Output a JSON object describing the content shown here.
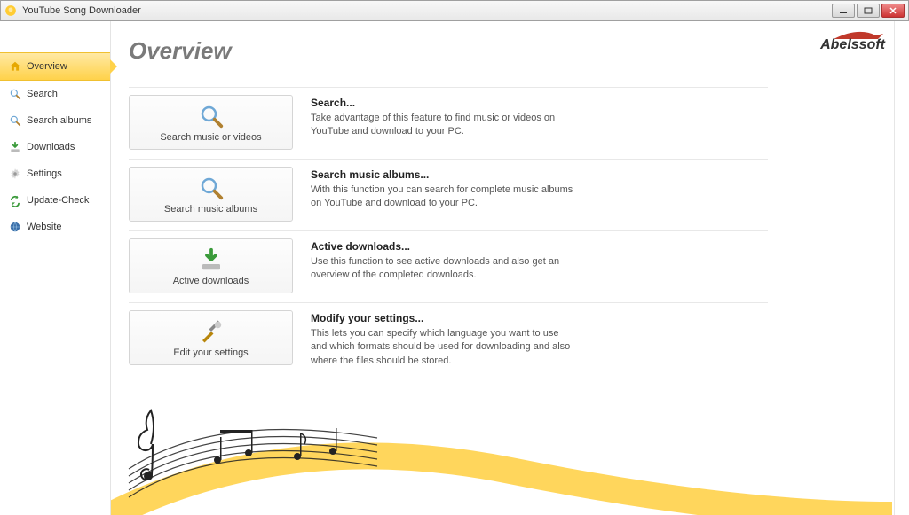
{
  "window": {
    "title": "YouTube Song Downloader"
  },
  "brand": {
    "name": "Abelssoft"
  },
  "page": {
    "title": "Overview"
  },
  "sidebar": {
    "items": [
      {
        "label": "Overview",
        "icon": "home-icon"
      },
      {
        "label": "Search",
        "icon": "search-icon"
      },
      {
        "label": "Search albums",
        "icon": "search-icon"
      },
      {
        "label": "Downloads",
        "icon": "download-icon"
      },
      {
        "label": "Settings",
        "icon": "gear-icon"
      },
      {
        "label": "Update-Check",
        "icon": "refresh-icon"
      },
      {
        "label": "Website",
        "icon": "globe-icon"
      }
    ]
  },
  "cards": [
    {
      "button_label": "Search music or videos",
      "title": "Search...",
      "desc": "Take advantage of this feature to find music or videos on YouTube and download to your PC.",
      "icon": "search-icon"
    },
    {
      "button_label": "Search music albums",
      "title": "Search music albums...",
      "desc": "With this function you can search for complete music albums on YouTube and download to your PC.",
      "icon": "search-icon"
    },
    {
      "button_label": "Active downloads",
      "title": "Active downloads...",
      "desc": "Use this function to see active downloads and also get an overview of the completed downloads.",
      "icon": "download-icon"
    },
    {
      "button_label": "Edit your settings",
      "title": "Modify your settings...",
      "desc": "This lets you can specify which language you want to use and which formats should be used for downloading and also where the files should be stored.",
      "icon": "tools-icon"
    }
  ]
}
